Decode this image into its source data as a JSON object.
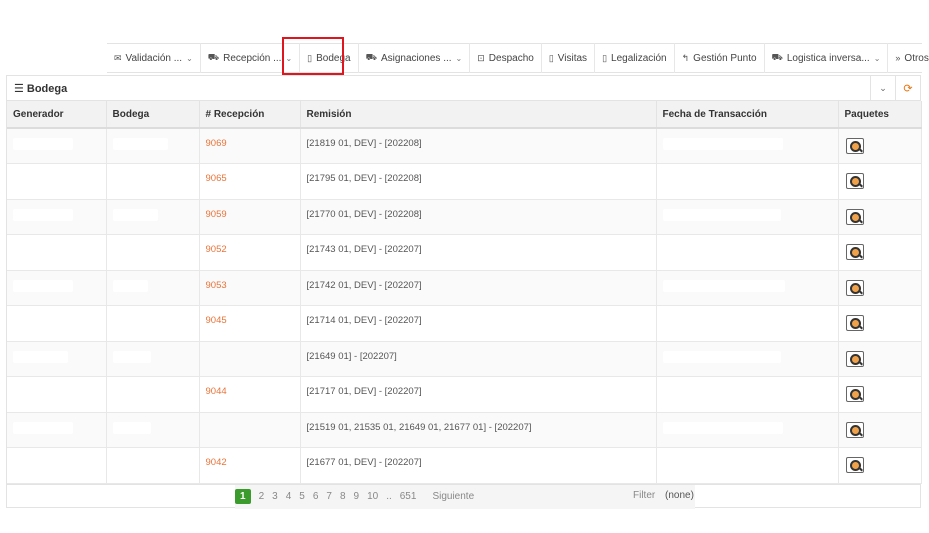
{
  "nav": [
    {
      "icon": "envelope-icon",
      "glyph": "✉",
      "label": "Validación ...",
      "chevron": true
    },
    {
      "icon": "truck-icon",
      "glyph": "⛟",
      "label": "Recepción ...",
      "chevron": true
    },
    {
      "icon": "warehouse-icon",
      "glyph": "▯",
      "label": "Bodega",
      "chevron": false
    },
    {
      "icon": "truck-icon",
      "glyph": "⛟",
      "label": "Asignaciones ...",
      "chevron": true
    },
    {
      "icon": "dispatch-icon",
      "glyph": "⊡",
      "label": "Despacho",
      "chevron": false
    },
    {
      "icon": "document-icon",
      "glyph": "▯",
      "label": "Visitas",
      "chevron": false
    },
    {
      "icon": "document-icon",
      "glyph": "▯",
      "label": "Legalización",
      "chevron": false
    },
    {
      "icon": "reply-icon",
      "glyph": "↰",
      "label": "Gestión Punto",
      "chevron": false
    },
    {
      "icon": "truck-icon",
      "glyph": "⛟",
      "label": "Logistica inversa...",
      "chevron": true
    },
    {
      "icon": "double-chevron-icon",
      "glyph": "»",
      "label": "Otros ...",
      "chevron": true
    }
  ],
  "panel": {
    "title": "Bodega",
    "collapse_glyph": "⌄",
    "refresh_glyph": "⟳"
  },
  "table": {
    "headers": [
      "Generador",
      "Bodega",
      "# Recepción",
      "Remisión",
      "Fecha de Transacción",
      "Paquetes"
    ],
    "rows": [
      {
        "recepcion": "9069",
        "remision": "[21819 01, DEV] - [202208]"
      },
      {
        "recepcion": "9065",
        "remision": "[21795 01, DEV] - [202208]"
      },
      {
        "recepcion": "9059",
        "remision": "[21770 01, DEV] - [202208]"
      },
      {
        "recepcion": "9052",
        "remision": "[21743 01, DEV] - [202207]"
      },
      {
        "recepcion": "9053",
        "remision": "[21742 01, DEV] - [202207]"
      },
      {
        "recepcion": "9045",
        "remision": "[21714 01, DEV] - [202207]"
      },
      {
        "recepcion": "",
        "remision": "[21649 01] - [202207]"
      },
      {
        "recepcion": "9044",
        "remision": "[21717 01, DEV] - [202207]"
      },
      {
        "recepcion": "",
        "remision": "[21519 01, 21535 01, 21649 01, 21677 01] - [202207]"
      },
      {
        "recepcion": "9042",
        "remision": "[21677 01, DEV] - [202207]"
      }
    ]
  },
  "pager": {
    "pages": [
      "1",
      "2",
      "3",
      "4",
      "5",
      "6",
      "7",
      "8",
      "9",
      "10",
      "..",
      "651"
    ],
    "current": "1",
    "next_label": "Siguiente",
    "filter_label": "Filter",
    "filter_value": "(none)"
  }
}
